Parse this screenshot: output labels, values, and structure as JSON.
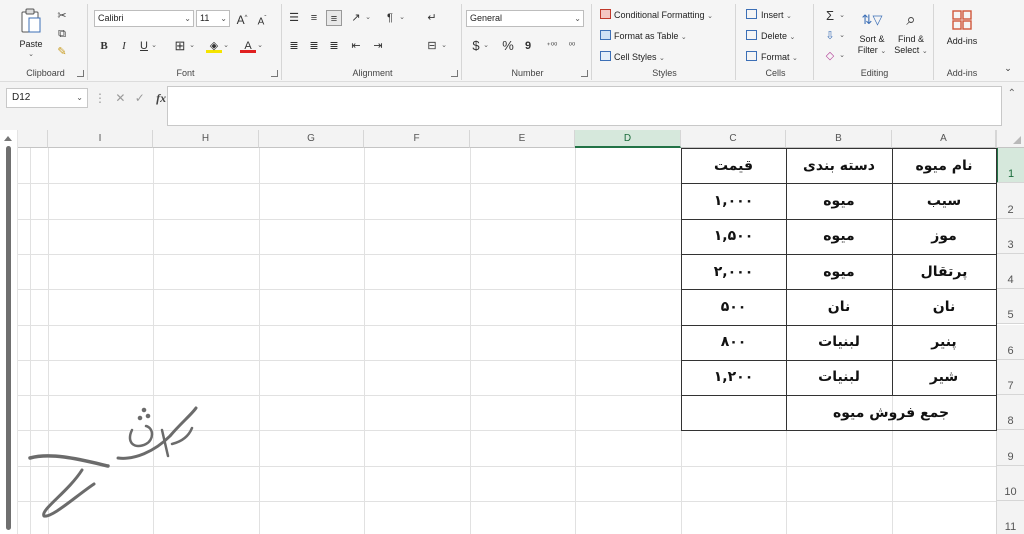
{
  "ribbon": {
    "clipboard": {
      "label": "Clipboard",
      "paste": "Paste"
    },
    "font": {
      "label": "Font",
      "name": "Calibri",
      "size": "11",
      "grow": "A",
      "shrink": "A",
      "bold": "B",
      "italic": "I",
      "underline": "U",
      "font_color": "A"
    },
    "alignment": {
      "label": "Alignment"
    },
    "number": {
      "label": "Number",
      "format": "General",
      "currency": "$",
      "percent": "%",
      "comma": "9"
    },
    "styles": {
      "label": "Styles",
      "conditional": "Conditional Formatting",
      "format_table": "Format as Table",
      "cell_styles": "Cell Styles"
    },
    "cells": {
      "label": "Cells",
      "insert": "Insert",
      "delete": "Delete",
      "format": "Format"
    },
    "editing": {
      "label": "Editing",
      "sort_filter_1": "Sort &",
      "sort_filter_2": "Filter",
      "find_select_1": "Find &",
      "find_select_2": "Select",
      "sum": "Σ"
    },
    "addins": {
      "label": "Add-ins",
      "button": "Add-ins"
    }
  },
  "formula_bar": {
    "name_box": "D12",
    "cancel": "✕",
    "enter": "✓",
    "fx": "fx",
    "value": ""
  },
  "columns": [
    "I",
    "H",
    "G",
    "F",
    "E",
    "D",
    "C",
    "B",
    "A"
  ],
  "rows": [
    "1",
    "2",
    "3",
    "4",
    "5",
    "6",
    "7",
    "8",
    "9",
    "10",
    "11"
  ],
  "table": {
    "headers": {
      "A": "نام میوه",
      "B": "دسته بندی",
      "C": "قیمت"
    },
    "rows": [
      {
        "A": "سیب",
        "B": "میوه",
        "C": "۱,۰۰۰"
      },
      {
        "A": "موز",
        "B": "میوه",
        "C": "۱,۵۰۰"
      },
      {
        "A": "پرتقال",
        "B": "میوه",
        "C": "۲,۰۰۰"
      },
      {
        "A": "نان",
        "B": "نان",
        "C": "۵۰۰"
      },
      {
        "A": "پنیر",
        "B": "لبنیات",
        "C": "۸۰۰"
      },
      {
        "A": "شیر",
        "B": "لبنیات",
        "C": "۱,۲۰۰"
      }
    ],
    "total_label": "جمع فروش میوه",
    "total_value": ""
  },
  "selection": {
    "active_col": "D",
    "active_row": "1"
  },
  "watermark": {
    "text": "آموزش",
    "color": "#6b6b6b"
  }
}
